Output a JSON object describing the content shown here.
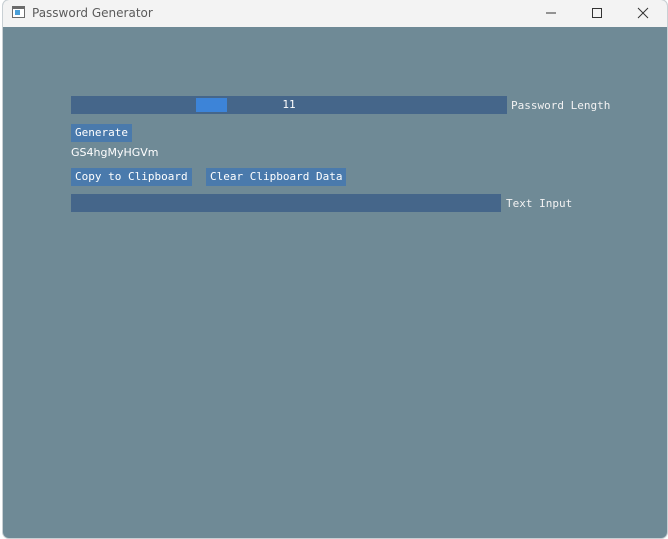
{
  "window": {
    "title": "Password Generator"
  },
  "titlebar_icons": {
    "app": "app-window-icon",
    "minimize": "minimize-icon",
    "maximize": "maximize-icon",
    "close": "close-icon"
  },
  "password_length": {
    "value": "11",
    "label": "Password Length"
  },
  "buttons": {
    "generate": "Generate",
    "copy": "Copy to Clipboard",
    "clear": "Clear Clipboard Data"
  },
  "generated_password": "GS4hgMyHGVm",
  "text_input": {
    "value": "",
    "label": "Text Input"
  },
  "colors": {
    "background": "#6f8a96",
    "frame": "#45668a",
    "button": "#4a7aac",
    "slider_grab": "#3d84d8"
  }
}
